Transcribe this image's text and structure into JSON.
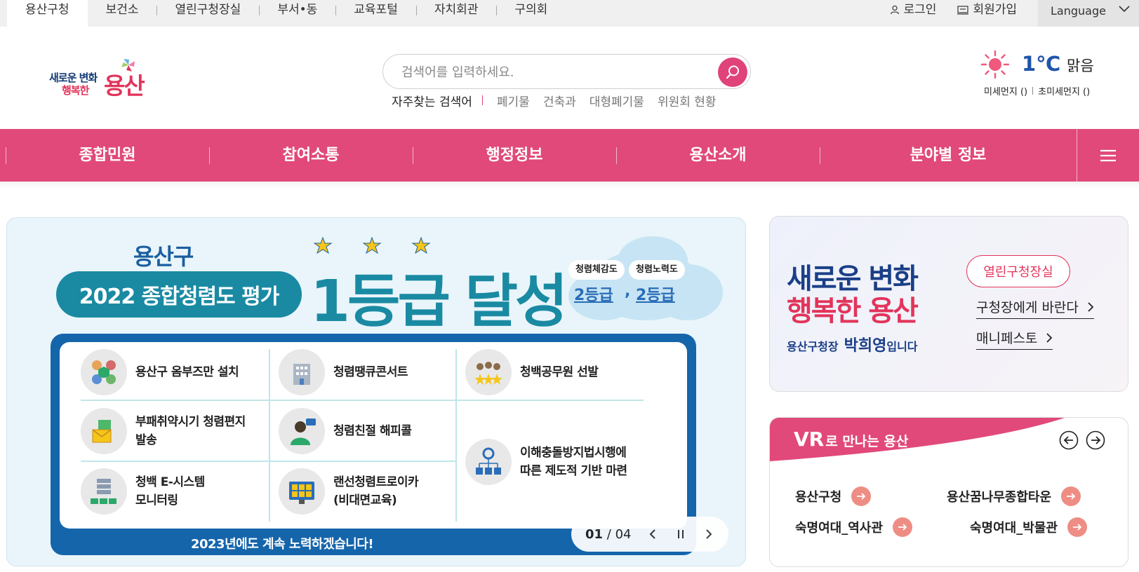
{
  "topnav": {
    "items": [
      "용산구청",
      "보건소",
      "열린구청장실",
      "부서•동",
      "교육포털",
      "자치회관",
      "구의회"
    ],
    "login": "로그인",
    "signup": "회원가입",
    "language": "Language"
  },
  "logo": {
    "line1": "새로운 변화",
    "line2": "행복한",
    "line3": "용산"
  },
  "search": {
    "placeholder": "검색어를 입력하세요.",
    "popular_label": "자주찾는 검색어",
    "keywords": [
      "폐기물",
      "건축과",
      "대형폐기물",
      "위원회 현황"
    ]
  },
  "weather": {
    "temperature": "1℃",
    "condition": "맑음",
    "fine_dust": "미세먼지 ()",
    "ultrafine_dust": "초미세먼지 ()"
  },
  "mainnav": {
    "items": [
      "종합민원",
      "참여소통",
      "행정정보",
      "용산소개",
      "분야별 정보"
    ]
  },
  "banner": {
    "org": "용산구",
    "subtitle": "2022 종합청렴도 평가",
    "headline": "1등급 달성",
    "tag1": "청렴체감도",
    "tag2": "청렴노력도",
    "grade1": "2등급",
    "grade_sep": ",",
    "grade2": "2등급",
    "cells": [
      "용산구 옴부즈만 설치",
      "청렴땡큐콘서트",
      "청백공무원 선발",
      "부패취약시기 청렴편지\n발송",
      "청렴친절 해피콜",
      "이해충돌방지법시행에\n따른 제도적 기반 마련",
      "청백 E-시스템\n모니터링",
      "랜선청렴트로이카\n(비대면교육)"
    ],
    "footer": "2023년에도 계속 노력하겠습니다!",
    "page_current": "01",
    "page_total": "/ 04"
  },
  "card1": {
    "slogan1": "새로운 변화",
    "slogan2": "행복한 용산",
    "mayor_prefix": "용산구청장",
    "mayor_name": "박희영",
    "mayor_suffix": "입니다",
    "open_office": "열린구청장실",
    "link1": "구청장에게 바란다",
    "link2": "매니페스토"
  },
  "card2": {
    "title_vr": "VR",
    "title_rest": "로 만나는 용산",
    "links": [
      "용산구청",
      "용산꿈나무종합타운",
      "숙명여대_역사관",
      "숙명여대_박물관"
    ]
  },
  "colors": {
    "brand_pink": "#e1497a",
    "brand_navy": "#1a3f87",
    "banner_teal": "#1a8aa3",
    "weather_blue": "#1f55a8"
  }
}
